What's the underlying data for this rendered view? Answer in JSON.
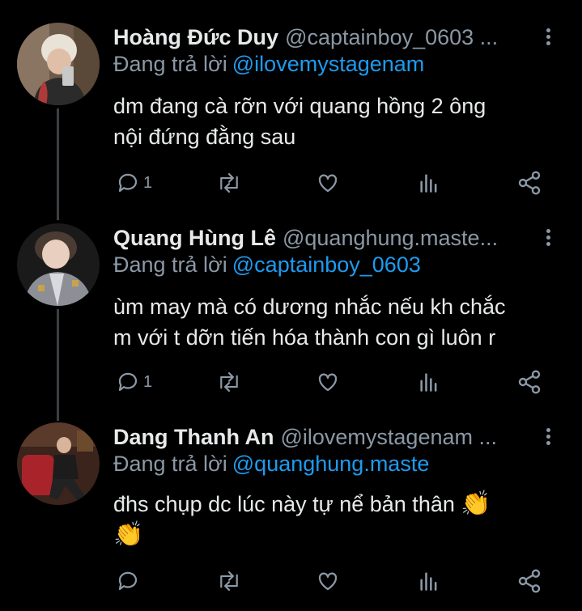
{
  "tweets": [
    {
      "name": "Hoàng Đức Duy",
      "handle": "@captainboy_0603 ...",
      "reply_prefix": "Đang trả lời",
      "reply_to": "@ilovemystagenam",
      "text_lines": [
        "dm đang cà rỡn với quang hồng 2 ông",
        "nội đứng đằng sau"
      ],
      "reply_count": "1"
    },
    {
      "name": "Quang Hùng Lê",
      "handle": "@quanghung.maste...",
      "reply_prefix": "Đang trả lời",
      "reply_to": "@captainboy_0603",
      "text_lines": [
        "ùm may mà có dương nhắc nếu kh chắc",
        "m với t dỡn tiến hóa thành con gì luôn r"
      ],
      "reply_count": "1"
    },
    {
      "name": "Dang Thanh An",
      "handle": "@ilovemystagenam ...",
      "reply_prefix": "Đang trả lời",
      "reply_to": "@quanghung.maste",
      "text_lines": [
        "đhs chụp dc lúc này tự nể bản thân"
      ],
      "emoji": "👏",
      "reply_count": ""
    }
  ],
  "icons": [
    "reply-icon",
    "retweet-icon",
    "like-icon",
    "analytics-icon",
    "share-icon",
    "more-icon"
  ],
  "colors": {
    "background": "#000000",
    "text": "#e7e9ea",
    "secondary": "#8b98a5",
    "link": "#1d9bf0"
  }
}
